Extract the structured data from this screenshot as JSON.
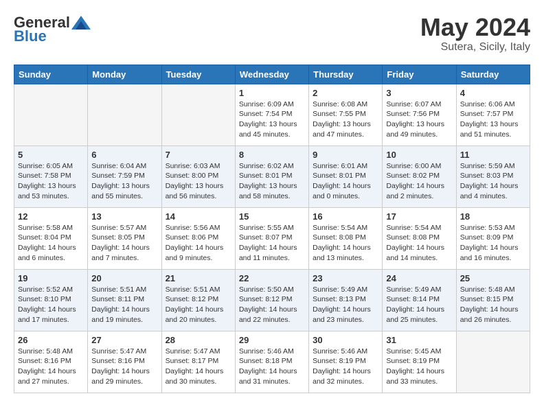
{
  "header": {
    "logo_general": "General",
    "logo_blue": "Blue",
    "month_title": "May 2024",
    "subtitle": "Sutera, Sicily, Italy"
  },
  "days_of_week": [
    "Sunday",
    "Monday",
    "Tuesday",
    "Wednesday",
    "Thursday",
    "Friday",
    "Saturday"
  ],
  "weeks": [
    [
      {
        "day": "",
        "sunrise": "",
        "sunset": "",
        "daylight": "",
        "empty": true
      },
      {
        "day": "",
        "sunrise": "",
        "sunset": "",
        "daylight": "",
        "empty": true
      },
      {
        "day": "",
        "sunrise": "",
        "sunset": "",
        "daylight": "",
        "empty": true
      },
      {
        "day": "1",
        "sunrise": "Sunrise: 6:09 AM",
        "sunset": "Sunset: 7:54 PM",
        "daylight": "Daylight: 13 hours and 45 minutes."
      },
      {
        "day": "2",
        "sunrise": "Sunrise: 6:08 AM",
        "sunset": "Sunset: 7:55 PM",
        "daylight": "Daylight: 13 hours and 47 minutes."
      },
      {
        "day": "3",
        "sunrise": "Sunrise: 6:07 AM",
        "sunset": "Sunset: 7:56 PM",
        "daylight": "Daylight: 13 hours and 49 minutes."
      },
      {
        "day": "4",
        "sunrise": "Sunrise: 6:06 AM",
        "sunset": "Sunset: 7:57 PM",
        "daylight": "Daylight: 13 hours and 51 minutes."
      }
    ],
    [
      {
        "day": "5",
        "sunrise": "Sunrise: 6:05 AM",
        "sunset": "Sunset: 7:58 PM",
        "daylight": "Daylight: 13 hours and 53 minutes."
      },
      {
        "day": "6",
        "sunrise": "Sunrise: 6:04 AM",
        "sunset": "Sunset: 7:59 PM",
        "daylight": "Daylight: 13 hours and 55 minutes."
      },
      {
        "day": "7",
        "sunrise": "Sunrise: 6:03 AM",
        "sunset": "Sunset: 8:00 PM",
        "daylight": "Daylight: 13 hours and 56 minutes."
      },
      {
        "day": "8",
        "sunrise": "Sunrise: 6:02 AM",
        "sunset": "Sunset: 8:01 PM",
        "daylight": "Daylight: 13 hours and 58 minutes."
      },
      {
        "day": "9",
        "sunrise": "Sunrise: 6:01 AM",
        "sunset": "Sunset: 8:01 PM",
        "daylight": "Daylight: 14 hours and 0 minutes."
      },
      {
        "day": "10",
        "sunrise": "Sunrise: 6:00 AM",
        "sunset": "Sunset: 8:02 PM",
        "daylight": "Daylight: 14 hours and 2 minutes."
      },
      {
        "day": "11",
        "sunrise": "Sunrise: 5:59 AM",
        "sunset": "Sunset: 8:03 PM",
        "daylight": "Daylight: 14 hours and 4 minutes."
      }
    ],
    [
      {
        "day": "12",
        "sunrise": "Sunrise: 5:58 AM",
        "sunset": "Sunset: 8:04 PM",
        "daylight": "Daylight: 14 hours and 6 minutes."
      },
      {
        "day": "13",
        "sunrise": "Sunrise: 5:57 AM",
        "sunset": "Sunset: 8:05 PM",
        "daylight": "Daylight: 14 hours and 7 minutes."
      },
      {
        "day": "14",
        "sunrise": "Sunrise: 5:56 AM",
        "sunset": "Sunset: 8:06 PM",
        "daylight": "Daylight: 14 hours and 9 minutes."
      },
      {
        "day": "15",
        "sunrise": "Sunrise: 5:55 AM",
        "sunset": "Sunset: 8:07 PM",
        "daylight": "Daylight: 14 hours and 11 minutes."
      },
      {
        "day": "16",
        "sunrise": "Sunrise: 5:54 AM",
        "sunset": "Sunset: 8:08 PM",
        "daylight": "Daylight: 14 hours and 13 minutes."
      },
      {
        "day": "17",
        "sunrise": "Sunrise: 5:54 AM",
        "sunset": "Sunset: 8:08 PM",
        "daylight": "Daylight: 14 hours and 14 minutes."
      },
      {
        "day": "18",
        "sunrise": "Sunrise: 5:53 AM",
        "sunset": "Sunset: 8:09 PM",
        "daylight": "Daylight: 14 hours and 16 minutes."
      }
    ],
    [
      {
        "day": "19",
        "sunrise": "Sunrise: 5:52 AM",
        "sunset": "Sunset: 8:10 PM",
        "daylight": "Daylight: 14 hours and 17 minutes."
      },
      {
        "day": "20",
        "sunrise": "Sunrise: 5:51 AM",
        "sunset": "Sunset: 8:11 PM",
        "daylight": "Daylight: 14 hours and 19 minutes."
      },
      {
        "day": "21",
        "sunrise": "Sunrise: 5:51 AM",
        "sunset": "Sunset: 8:12 PM",
        "daylight": "Daylight: 14 hours and 20 minutes."
      },
      {
        "day": "22",
        "sunrise": "Sunrise: 5:50 AM",
        "sunset": "Sunset: 8:12 PM",
        "daylight": "Daylight: 14 hours and 22 minutes."
      },
      {
        "day": "23",
        "sunrise": "Sunrise: 5:49 AM",
        "sunset": "Sunset: 8:13 PM",
        "daylight": "Daylight: 14 hours and 23 minutes."
      },
      {
        "day": "24",
        "sunrise": "Sunrise: 5:49 AM",
        "sunset": "Sunset: 8:14 PM",
        "daylight": "Daylight: 14 hours and 25 minutes."
      },
      {
        "day": "25",
        "sunrise": "Sunrise: 5:48 AM",
        "sunset": "Sunset: 8:15 PM",
        "daylight": "Daylight: 14 hours and 26 minutes."
      }
    ],
    [
      {
        "day": "26",
        "sunrise": "Sunrise: 5:48 AM",
        "sunset": "Sunset: 8:16 PM",
        "daylight": "Daylight: 14 hours and 27 minutes."
      },
      {
        "day": "27",
        "sunrise": "Sunrise: 5:47 AM",
        "sunset": "Sunset: 8:16 PM",
        "daylight": "Daylight: 14 hours and 29 minutes."
      },
      {
        "day": "28",
        "sunrise": "Sunrise: 5:47 AM",
        "sunset": "Sunset: 8:17 PM",
        "daylight": "Daylight: 14 hours and 30 minutes."
      },
      {
        "day": "29",
        "sunrise": "Sunrise: 5:46 AM",
        "sunset": "Sunset: 8:18 PM",
        "daylight": "Daylight: 14 hours and 31 minutes."
      },
      {
        "day": "30",
        "sunrise": "Sunrise: 5:46 AM",
        "sunset": "Sunset: 8:19 PM",
        "daylight": "Daylight: 14 hours and 32 minutes."
      },
      {
        "day": "31",
        "sunrise": "Sunrise: 5:45 AM",
        "sunset": "Sunset: 8:19 PM",
        "daylight": "Daylight: 14 hours and 33 minutes."
      },
      {
        "day": "",
        "sunrise": "",
        "sunset": "",
        "daylight": "",
        "empty": true
      }
    ]
  ]
}
